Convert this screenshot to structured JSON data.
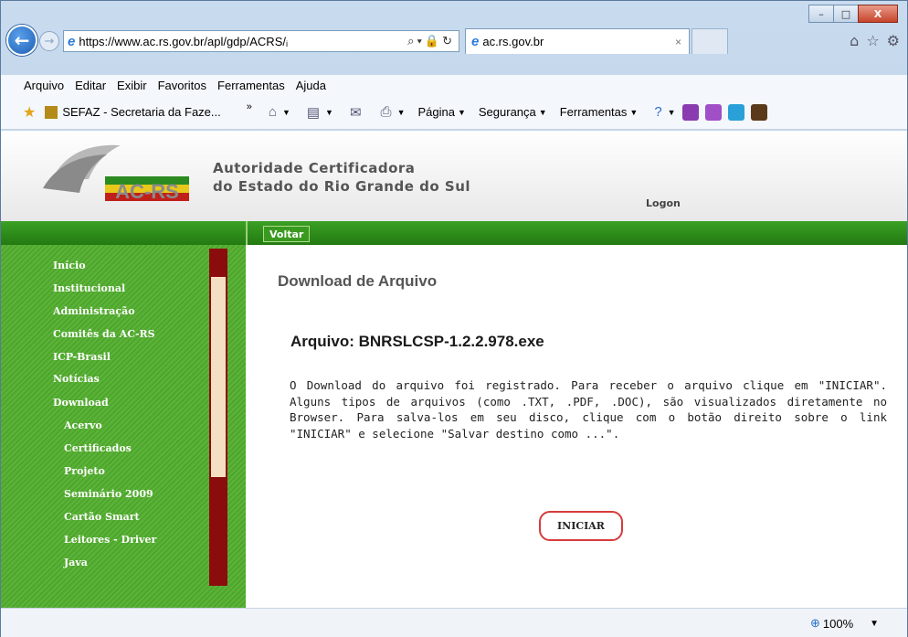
{
  "browser": {
    "url": "https://www.ac.rs.gov.br/apl/gdp/ACRS/ᵢ",
    "tab_title": "ac.rs.gov.br",
    "tab_close": "×",
    "window_controls": {
      "minimize": "–",
      "maximize": "□",
      "close": "X"
    }
  },
  "menubar": [
    "Arquivo",
    "Editar",
    "Exibir",
    "Favoritos",
    "Ferramentas",
    "Ajuda"
  ],
  "favorites": {
    "item": "SEFAZ - Secretaria da Faze...",
    "chevron": "»",
    "commands": {
      "pagina": "Página",
      "seguranca": "Segurança",
      "ferramentas": "Ferramentas"
    }
  },
  "site": {
    "logo_text": "AC-RS",
    "title_line1": "Autoridade Certificadora",
    "title_line2": "do Estado do Rio Grande do Sul",
    "logon": "Logon",
    "voltar": "Voltar"
  },
  "sidebar": [
    {
      "label": "Início",
      "sub": false
    },
    {
      "label": "Institucional",
      "sub": false
    },
    {
      "label": "Administração",
      "sub": false
    },
    {
      "label": "Comitês da AC-RS",
      "sub": false
    },
    {
      "label": "ICP-Brasil",
      "sub": false
    },
    {
      "label": "Notícias",
      "sub": false
    },
    {
      "label": "Download",
      "sub": false
    },
    {
      "label": "Acervo",
      "sub": true
    },
    {
      "label": "Certificados",
      "sub": true
    },
    {
      "label": "Projeto",
      "sub": true
    },
    {
      "label": "Seminário 2009",
      "sub": true
    },
    {
      "label": "Cartão Smart",
      "sub": true
    },
    {
      "label": "Leitores - Driver",
      "sub": true
    },
    {
      "label": "Java",
      "sub": true
    }
  ],
  "content": {
    "heading": "Download de Arquivo",
    "file": "Arquivo: BNRSLCSP-1.2.2.978.exe",
    "paragraph": "O Download do arquivo foi registrado. Para receber o arquivo clique em \"INICIAR\". Alguns tipos de arquivos (como .TXT, .PDF, .DOC), são visualizados diretamente no Browser. Para salva-los em seu disco, clique com o botão direito sobre o link \"INICIAR\" e selecione \"Salvar destino como ...\".",
    "button": "INICIAR"
  },
  "status": {
    "zoom": "100%"
  },
  "colors": {
    "green": "#3aa023",
    "scrollbar": "#8b0c0c",
    "button_border": "#d63b3b"
  }
}
